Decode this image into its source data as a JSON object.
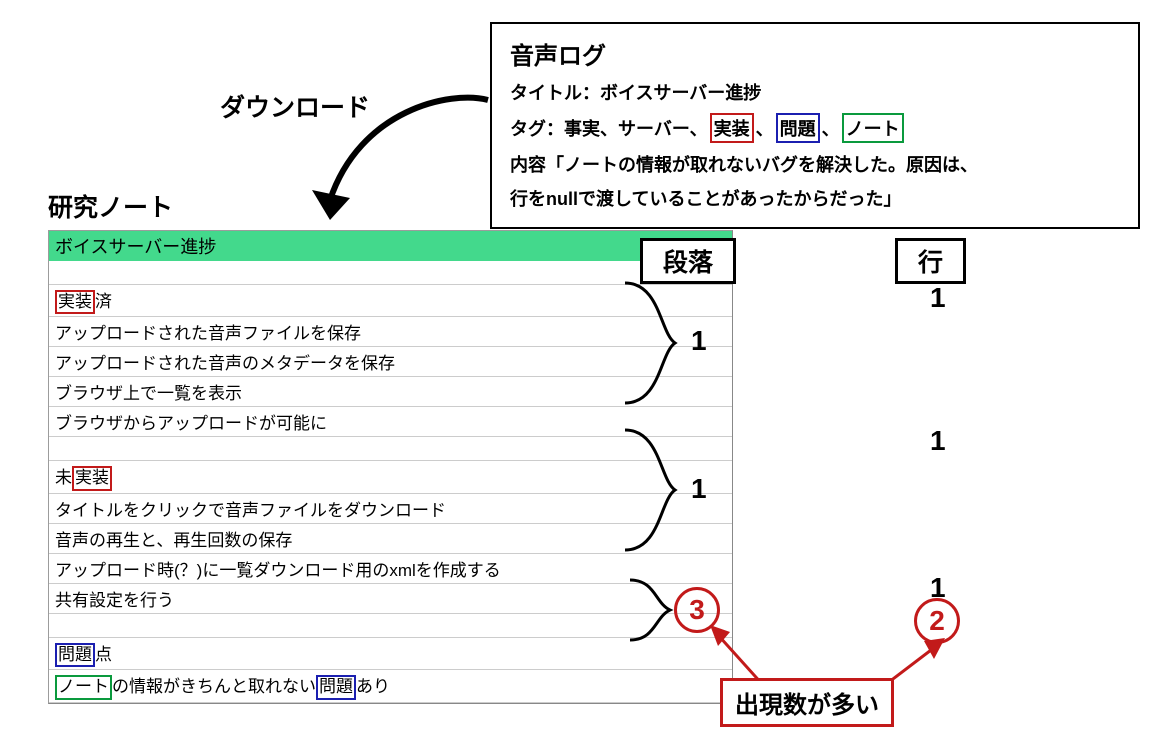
{
  "labels": {
    "download": "ダウンロード",
    "research_note": "研究ノート",
    "paragraph_header": "段落",
    "row_header": "行",
    "callout": "出現数が多い"
  },
  "audio_log": {
    "heading": "音声ログ",
    "title_label": "タイトル：",
    "title_value": "ボイスサーバー進捗",
    "tag_label": "タグ：",
    "tags_prefix": "事実、サーバー、",
    "tag_red": "実装",
    "sep1": "、",
    "tag_blue": "問題",
    "sep2": "、",
    "tag_green": "ノート",
    "content_label": "内容",
    "content_line1": "「ノートの情報が取れないバグを解決した。原因は、",
    "content_line2": "行をnullで渡していることがあったからだった」"
  },
  "note": {
    "title": "ボイスサーバー進捗",
    "section1": {
      "header_pre": "",
      "header_red": "実装",
      "header_post": "済",
      "rows": [
        "アップロードされた音声ファイルを保存",
        "アップロードされた音声のメタデータを保存",
        "ブラウザ上で一覧を表示",
        "ブラウザからアップロードが可能に"
      ]
    },
    "section2": {
      "header_pre": "未",
      "header_red": "実装",
      "header_post": "",
      "rows": [
        "タイトルをクリックで音声ファイルをダウンロード",
        "音声の再生と、再生回数の保存",
        "アップロード時(？)に一覧ダウンロード用のxmlを作成する",
        "共有設定を行う"
      ]
    },
    "section3": {
      "header_blue": "問題",
      "header_post": "点",
      "row_green": "ノート",
      "row_mid": "の情報がきちんと取れない",
      "row_blue": "問題",
      "row_tail": "あり"
    }
  },
  "paragraph_scores": {
    "s1": "1",
    "s2": "1",
    "s3": "3"
  },
  "row_scores": {
    "r1": "1",
    "r2": "1",
    "r3a": "1",
    "r3b": "2"
  }
}
